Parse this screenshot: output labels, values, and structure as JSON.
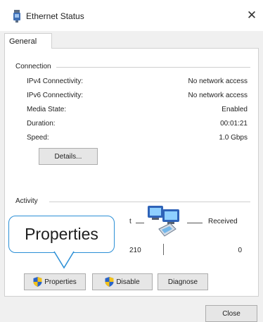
{
  "window": {
    "title": "Ethernet Status",
    "close_glyph": "✕"
  },
  "tabs": [
    {
      "label": "General",
      "selected": true
    }
  ],
  "connection": {
    "group_label": "Connection",
    "rows": [
      {
        "label": "IPv4 Connectivity:",
        "value": "No network access"
      },
      {
        "label": "IPv6 Connectivity:",
        "value": "No network access"
      },
      {
        "label": "Media State:",
        "value": "Enabled"
      },
      {
        "label": "Duration:",
        "value": "00:01:21"
      },
      {
        "label": "Speed:",
        "value": "1.0 Gbps"
      }
    ],
    "details_button": "Details..."
  },
  "activity": {
    "group_label": "Activity",
    "sent_label_fragment": "t",
    "received_label": "Received",
    "sent_value_fragment": "210",
    "received_value": "0"
  },
  "buttons": {
    "properties": "Properties",
    "disable": "Disable",
    "diagnose": "Diagnose",
    "close": "Close"
  },
  "callout": {
    "text": "Properties",
    "border_color": "#2b8fd6"
  },
  "icons": {
    "title": "ethernet-adapter-icon",
    "activity": "network-computers-icon",
    "shield": "uac-shield-icon"
  }
}
